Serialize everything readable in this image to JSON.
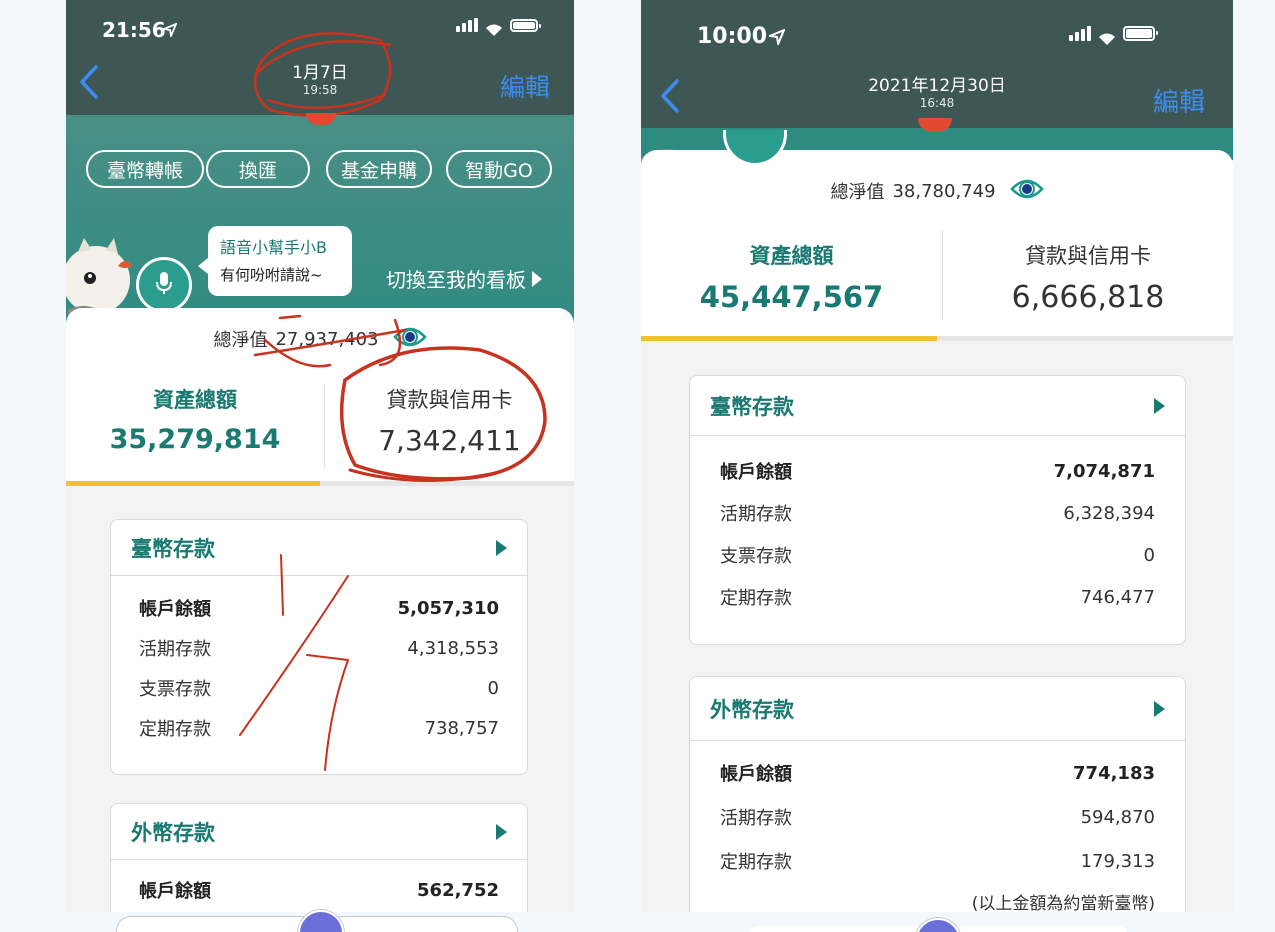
{
  "left": {
    "status": {
      "time": "21:56"
    },
    "nav": {
      "title": "1月7日",
      "subtitle": "19:58",
      "edit": "編輯"
    },
    "quick_actions": [
      "臺幣轉帳",
      "換匯",
      "基金申購",
      "智動GO"
    ],
    "assistant": {
      "title": "語音小幫手小B",
      "subtitle": "有何吩咐請說~",
      "switch_label": "切換至我的看板"
    },
    "net_worth": {
      "label": "總淨值",
      "value": "27,937,403"
    },
    "assets": {
      "label": "資產總額",
      "value": "35,279,814"
    },
    "loans": {
      "label": "貸款與信用卡",
      "value": "7,342,411"
    },
    "twd": {
      "title": "臺幣存款",
      "rows": [
        {
          "label": "帳戶餘額",
          "value": "5,057,310"
        },
        {
          "label": "活期存款",
          "value": "4,318,553"
        },
        {
          "label": "支票存款",
          "value": "0"
        },
        {
          "label": "定期存款",
          "value": "738,757"
        }
      ]
    },
    "fx": {
      "title": "外幣存款",
      "rows": [
        {
          "label": "帳戶餘額",
          "value": "562,752"
        }
      ]
    }
  },
  "right": {
    "status": {
      "time": "10:00"
    },
    "nav": {
      "title": "2021年12月30日",
      "subtitle": "16:48",
      "edit": "編輯"
    },
    "net_worth": {
      "label": "總淨值",
      "value": "38,780,749"
    },
    "assets": {
      "label": "資產總額",
      "value": "45,447,567"
    },
    "loans": {
      "label": "貸款與信用卡",
      "value": "6,666,818"
    },
    "twd": {
      "title": "臺幣存款",
      "rows": [
        {
          "label": "帳戶餘額",
          "value": "7,074,871"
        },
        {
          "label": "活期存款",
          "value": "6,328,394"
        },
        {
          "label": "支票存款",
          "value": "0"
        },
        {
          "label": "定期存款",
          "value": "746,477"
        }
      ]
    },
    "fx": {
      "title": "外幣存款",
      "rows": [
        {
          "label": "帳戶餘額",
          "value": "774,183"
        },
        {
          "label": "活期存款",
          "value": "594,870"
        },
        {
          "label": "定期存款",
          "value": "179,313"
        }
      ],
      "note": "(以上金額為約當新臺幣)"
    }
  },
  "colors": {
    "accent": "#1a7a72",
    "link": "#3b8ef0",
    "highlight": "#f2c12e",
    "annotation": "#c8321e"
  },
  "icons": [
    "back-chevron-icon",
    "location-arrow-icon",
    "signal-icon",
    "wifi-icon",
    "battery-icon",
    "eye-icon",
    "microphone-icon",
    "play-triangle-icon",
    "owl-mascot"
  ]
}
